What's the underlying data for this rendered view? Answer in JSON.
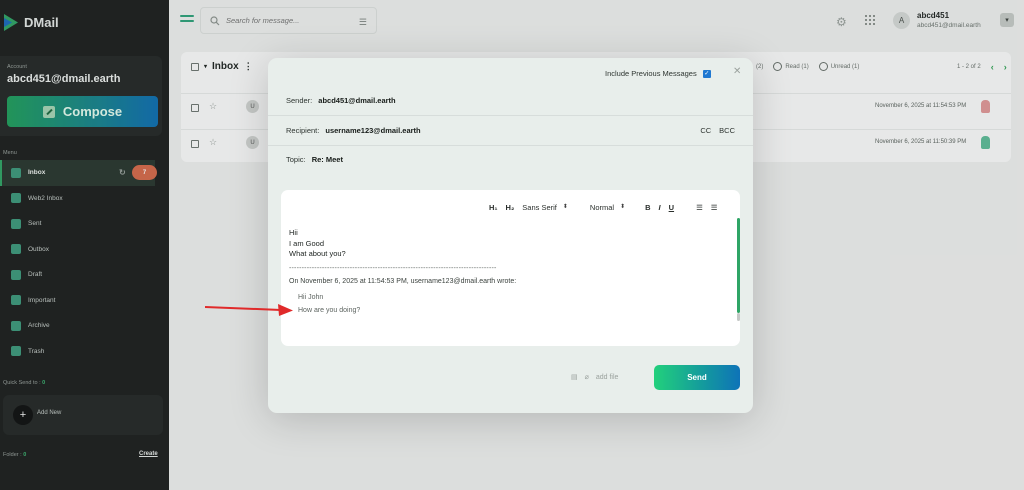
{
  "app": {
    "name": "DMail"
  },
  "sidebar": {
    "account_label": "Account",
    "account_email": "abcd451@dmail.earth",
    "compose_label": "Compose",
    "menu_label": "Menu",
    "items": [
      {
        "label": "Inbox",
        "icon": "inbox-icon",
        "badge": "7"
      },
      {
        "label": "Web2 Inbox",
        "icon": "web2-inbox-icon"
      },
      {
        "label": "Sent",
        "icon": "send-icon"
      },
      {
        "label": "Outbox",
        "icon": "outbox-icon"
      },
      {
        "label": "Draft",
        "icon": "draft-icon"
      },
      {
        "label": "Important",
        "icon": "star-icon"
      },
      {
        "label": "Archive",
        "icon": "archive-icon"
      },
      {
        "label": "Trash",
        "icon": "trash-icon"
      }
    ],
    "quick_send_label": "Quick Send to :",
    "quick_send_count": "0",
    "add_new_label": "Add New",
    "folder_label": "Folder :",
    "folder_count": "0",
    "create_label": "Create"
  },
  "topbar": {
    "search_placeholder": "Search for message...",
    "avatar_letter": "A",
    "user_name": "abcd451",
    "user_email": "abcd451@dmail.earth"
  },
  "inbox": {
    "title": "Inbox",
    "filters": [
      {
        "label": "(2)"
      },
      {
        "label": "Read (1)"
      },
      {
        "label": "Unread (1)"
      }
    ],
    "pager": "1 - 2 of 2",
    "rows": [
      {
        "avatar": "U",
        "date": "November 6, 2025 at 11:54:53 PM"
      },
      {
        "avatar": "U",
        "date": "November 6, 2025 at 11:50:39 PM"
      }
    ]
  },
  "compose_modal": {
    "include_previous_label": "Include Previous Messages",
    "include_previous_checked": true,
    "sender_label": "Sender:",
    "sender_value": "abcd451@dmail.earth",
    "recipient_label": "Recipient:",
    "recipient_value": "username123@dmail.earth",
    "cc_label": "CC",
    "bcc_label": "BCC",
    "topic_label": "Topic:",
    "topic_value": "Re: Meet",
    "toolbar": {
      "h1": "H₁",
      "h2": "H₂",
      "font": "Sans Serif",
      "size": "Normal",
      "bold": "B",
      "italic": "I",
      "underline": "U"
    },
    "body_lines": [
      "Hii",
      "I am Good",
      "What about you?"
    ],
    "separator": "----------------------------------------------------------------------------------",
    "wrote_line": "On November 6, 2025 at 11:54:53 PM, username123@dmail.earth wrote:",
    "quoted_lines": [
      "Hii John",
      "How are you doing?"
    ],
    "add_file_label": "add file",
    "send_label": "Send"
  },
  "colors": {
    "sidebar_bg": "#1c1e1d",
    "accent_green": "#2fa566",
    "badge": "#d96a4a",
    "send_gradient_start": "#22d07c",
    "send_gradient_end": "#0e73b8",
    "annotation_arrow": "#e02a2a"
  }
}
